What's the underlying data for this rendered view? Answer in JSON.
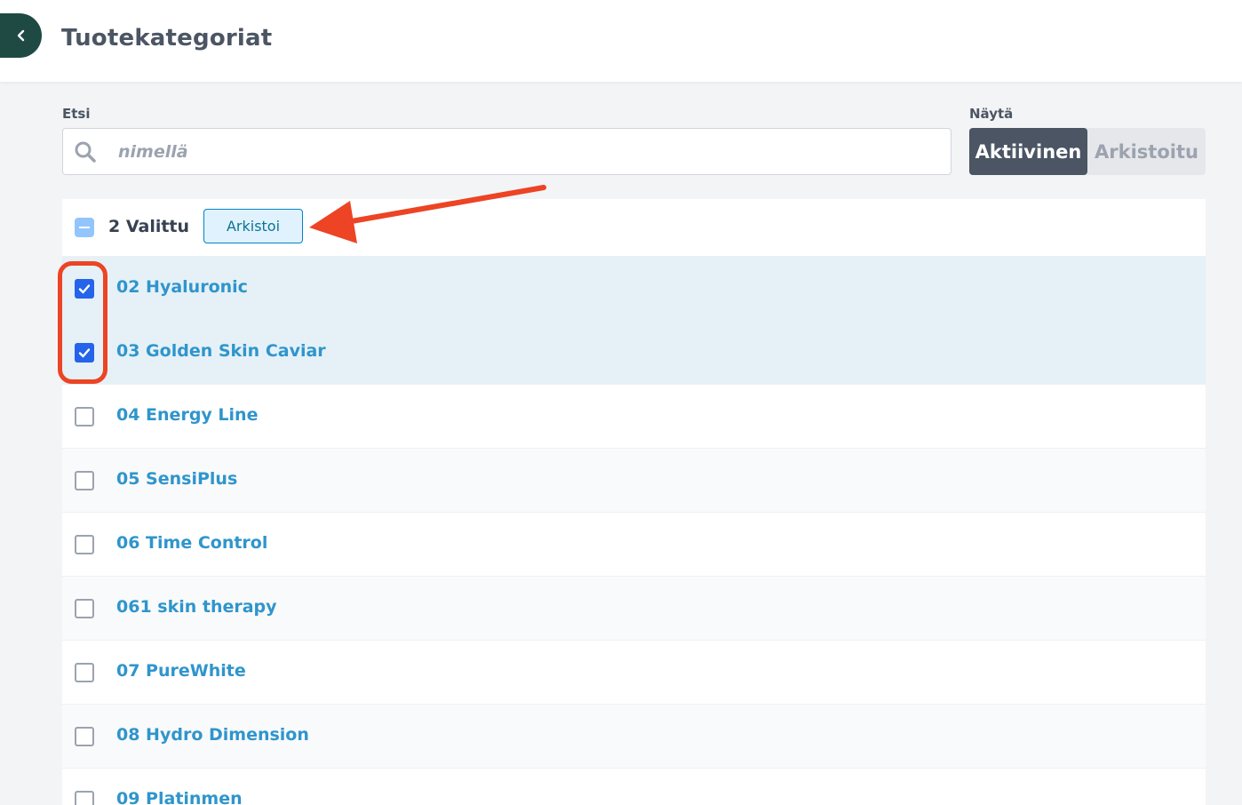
{
  "header": {
    "title": "Tuotekategoriat",
    "back_icon": "chevron-left-icon"
  },
  "filters": {
    "search_label": "Etsi",
    "search_placeholder": "nimellä",
    "search_value": "",
    "show_label": "Näytä",
    "toggle_active": "Aktiivinen",
    "toggle_archived": "Arkistoitu"
  },
  "bulk": {
    "selected_text": "2 Valittu",
    "archive_button": "Arkistoi"
  },
  "rows": [
    {
      "name": "02 Hyaluronic",
      "checked": true
    },
    {
      "name": "03 Golden Skin Caviar",
      "checked": true
    },
    {
      "name": "04 Energy Line",
      "checked": false
    },
    {
      "name": "05 SensiPlus",
      "checked": false
    },
    {
      "name": "06 Time Control",
      "checked": false
    },
    {
      "name": "061 skin therapy",
      "checked": false
    },
    {
      "name": "07 PureWhite",
      "checked": false
    },
    {
      "name": "08 Hydro Dimension",
      "checked": false
    },
    {
      "name": "09 Platinmen",
      "checked": false
    }
  ],
  "colors": {
    "accent": "#2f95cc",
    "header_back": "#1f4a44",
    "annotation": "#ec4424",
    "checkbox_checked": "#2563eb"
  }
}
